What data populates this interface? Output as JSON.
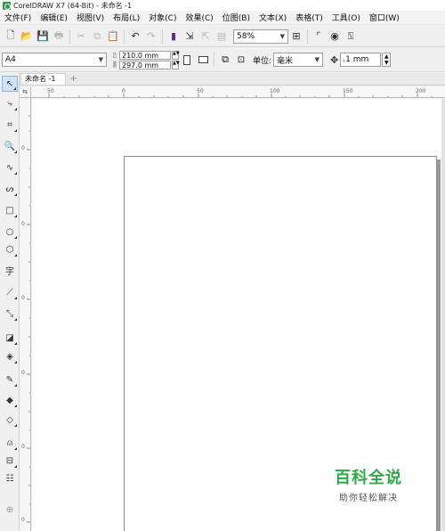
{
  "window": {
    "title": "CorelDRAW X7 (64-Bit) - 未命名 -1"
  },
  "menu": [
    "文件(F)",
    "编辑(E)",
    "视图(V)",
    "布局(L)",
    "对象(C)",
    "效果(C)",
    "位图(B)",
    "文本(X)",
    "表格(T)",
    "工具(O)",
    "窗口(W)"
  ],
  "toolbar": {
    "zoom": "58%"
  },
  "property_bar": {
    "page_size": "A4",
    "width": "210.0 mm",
    "height": "297.0 mm",
    "unit_label": "单位:",
    "unit_value": "毫米",
    "nudge": ".1 mm"
  },
  "document": {
    "tab_label": "未命名 -1",
    "add_tab": "+"
  },
  "ruler": {
    "corner": "⇆",
    "h_ticks": [
      "50",
      "0",
      "50",
      "100",
      "150",
      "200"
    ],
    "v_ticks": [
      "0",
      "0",
      "0",
      "0",
      "0",
      "0",
      "0",
      "0",
      "0",
      "0",
      "0",
      "0",
      "0",
      "0"
    ]
  },
  "watermark": {
    "main": "百科全说",
    "sub": "助你轻松解决"
  }
}
